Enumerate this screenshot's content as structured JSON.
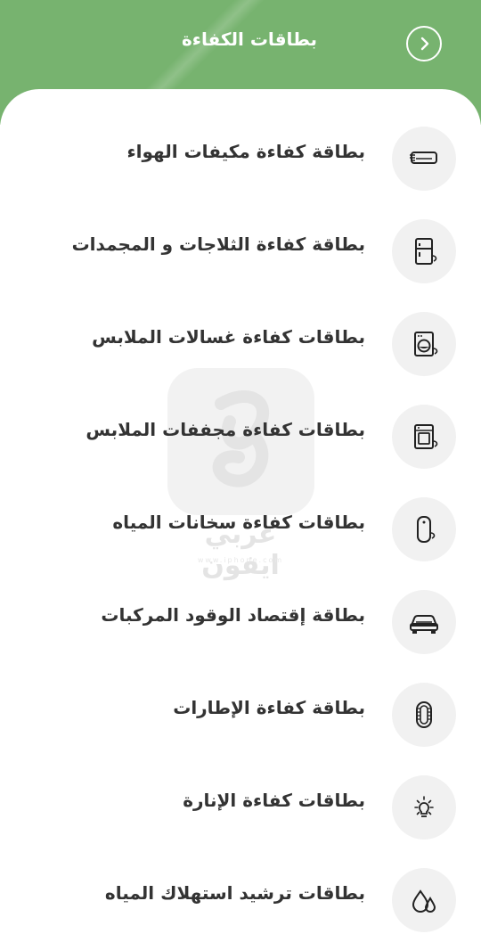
{
  "header": {
    "title": "بطاقات الكفاءة",
    "back_icon": "chevron-right-icon",
    "background_color": "#77b36f"
  },
  "watermark": {
    "text": "عربي ايفون",
    "sub": "www.iphone.com"
  },
  "items": [
    {
      "label": "بطاقة كفاءة مكيفات الهواء",
      "icon": "air-conditioner-icon"
    },
    {
      "label": "بطاقة كفاءة الثلاجات و المجمدات",
      "icon": "refrigerator-icon"
    },
    {
      "label": "بطاقات كفاءة غسالات الملابس",
      "icon": "washing-machine-icon"
    },
    {
      "label": "بطاقات كفاءة مجففات الملابس",
      "icon": "clothes-dryer-icon"
    },
    {
      "label": "بطاقات كفاءة سخانات المياه",
      "icon": "water-heater-icon"
    },
    {
      "label": "بطاقة إقتصاد الوقود المركبات",
      "icon": "car-icon"
    },
    {
      "label": "بطاقة كفاءة الإطارات",
      "icon": "tire-icon"
    },
    {
      "label": "بطاقات كفاءة الإنارة",
      "icon": "light-bulb-icon"
    },
    {
      "label": "بطاقات ترشيد استهلاك المياه",
      "icon": "water-drops-icon"
    }
  ]
}
